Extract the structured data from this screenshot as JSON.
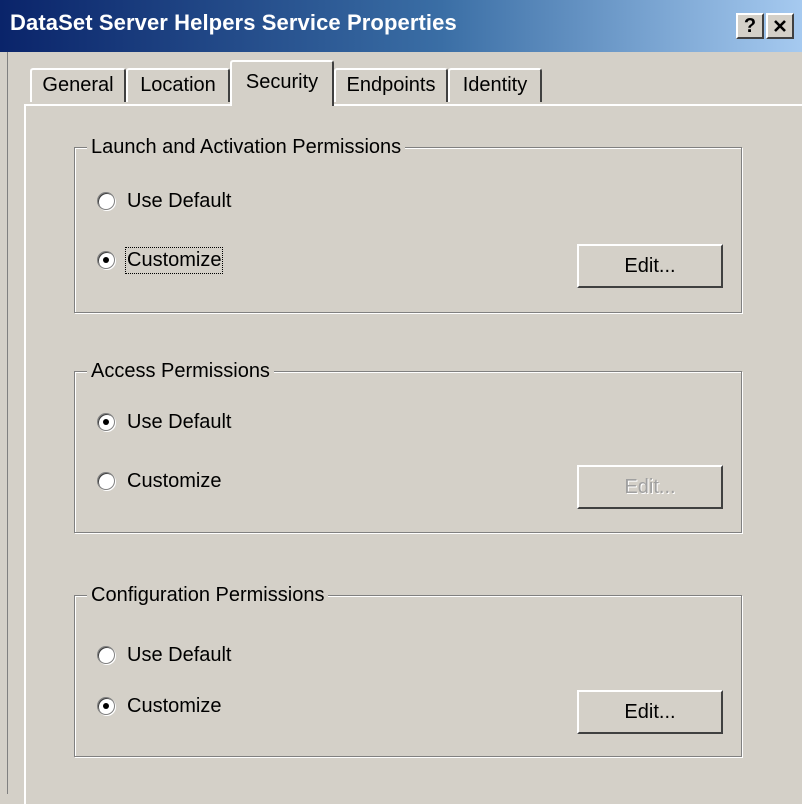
{
  "window": {
    "title": "DataSet Server Helpers Service Properties",
    "help_label": "?",
    "close_label": "X"
  },
  "tabs": [
    {
      "label": "General",
      "active": false
    },
    {
      "label": "Location",
      "active": false
    },
    {
      "label": "Security",
      "active": true
    },
    {
      "label": "Endpoints",
      "active": false
    },
    {
      "label": "Identity",
      "active": false
    }
  ],
  "groups": [
    {
      "title": "Launch and Activation Permissions",
      "options": [
        {
          "label": "Use Default",
          "checked": false
        },
        {
          "label": "Customize",
          "checked": true
        }
      ],
      "edit_label": "Edit...",
      "edit_enabled": true
    },
    {
      "title": "Access Permissions",
      "options": [
        {
          "label": "Use Default",
          "checked": true
        },
        {
          "label": "Customize",
          "checked": false
        }
      ],
      "edit_label": "Edit...",
      "edit_enabled": false
    },
    {
      "title": "Configuration Permissions",
      "options": [
        {
          "label": "Use Default",
          "checked": false
        },
        {
          "label": "Customize",
          "checked": true
        }
      ],
      "edit_label": "Edit...",
      "edit_enabled": true
    }
  ]
}
